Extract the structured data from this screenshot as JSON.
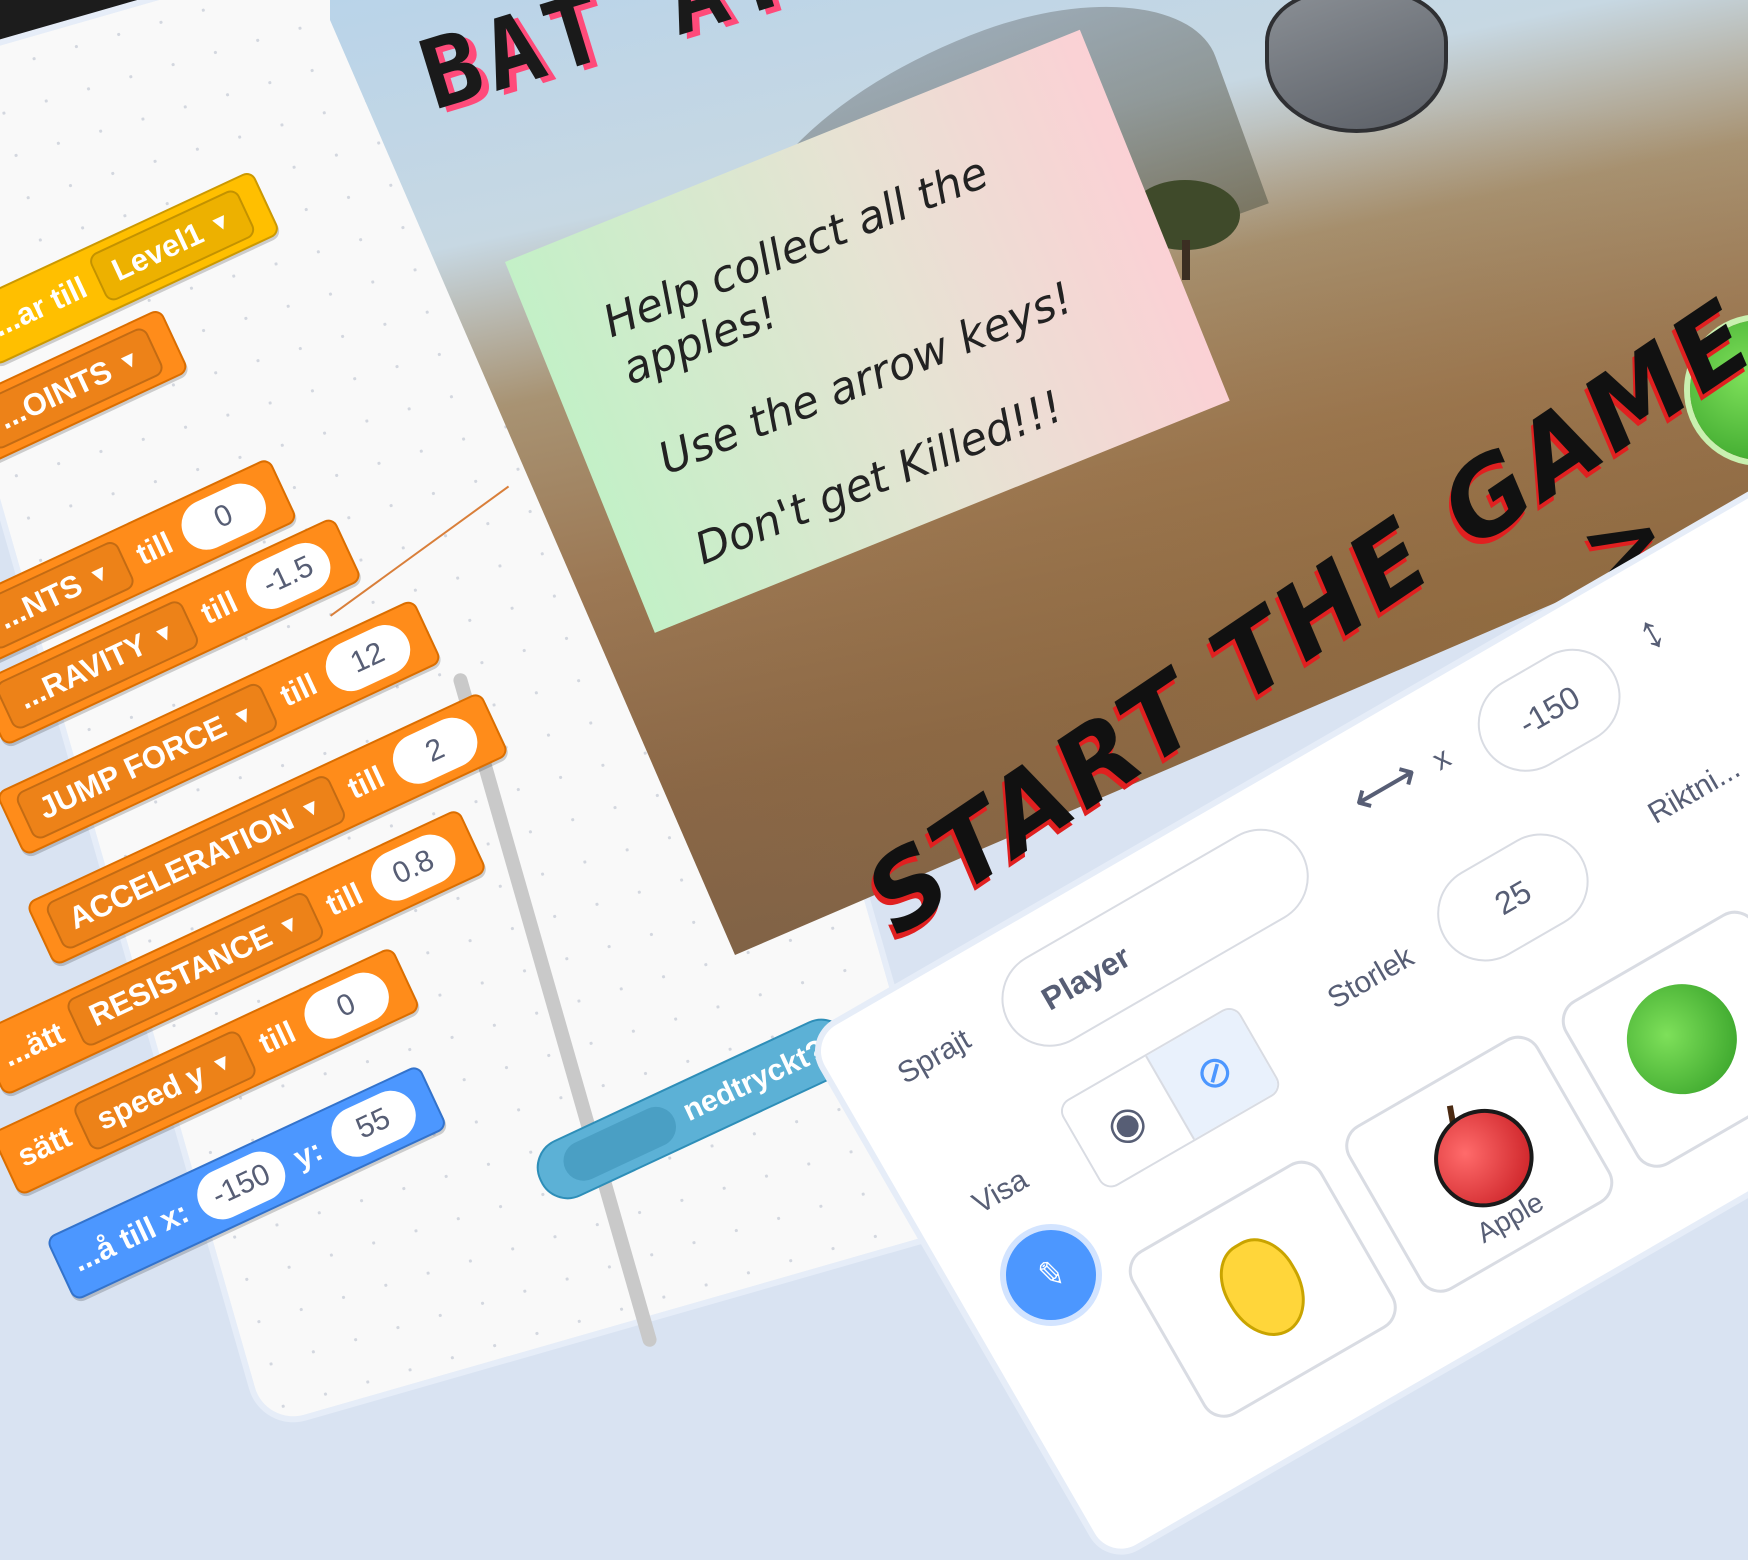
{
  "code": {
    "blocks": [
      {
        "prefix": "...ar till",
        "dropdown": "Level1"
      },
      {
        "dropdown": "...OINTS"
      },
      {
        "dropdown": "...NTS",
        "connector": "till",
        "value": "0"
      },
      {
        "dropdown": "...RAVITY",
        "connector": "till",
        "value": "-1.5"
      },
      {
        "dropdown": "JUMP FORCE",
        "connector": "till",
        "value": "12"
      },
      {
        "dropdown": "ACCELERATION",
        "connector": "till",
        "value": "2"
      },
      {
        "prefix": "...ätt",
        "dropdown": "RESISTANCE",
        "connector": "till",
        "value": "0.8"
      },
      {
        "prefix": "sätt",
        "dropdown": "speed y",
        "connector": "till",
        "value": "0"
      },
      {
        "prefix": "sätt",
        "dropdown": "speed y",
        "connector": "till",
        "value": "0"
      }
    ],
    "goto": {
      "label": "...å till x:",
      "x": "-150",
      "ylabel": "y:",
      "y": "55"
    },
    "sensing": {
      "label": "nedtryckt?"
    }
  },
  "stage": {
    "title": "BAT A...",
    "instructions": [
      "Help collect all the apples!",
      "Use the arrow keys!",
      "Don't get Killed!!!"
    ],
    "start": "START THE GAME",
    "arrow": ">"
  },
  "sprite_info": {
    "sprite_label": "Sprajt",
    "sprite_name": "Player",
    "x_label": "x",
    "x_value": "-150",
    "direction_label": "Riktni...",
    "size_label": "Storlek",
    "size_value": "25",
    "show_label": "Visa"
  },
  "sprites": [
    {
      "name": ""
    },
    {
      "name": "Apple"
    },
    {
      "name": ""
    }
  ],
  "icons": {
    "eye": "eye-icon",
    "eye_hidden": "eye-slash-icon",
    "horizontal": "horizontal-arrows-icon",
    "vertical": "vertical-arrows-icon"
  }
}
